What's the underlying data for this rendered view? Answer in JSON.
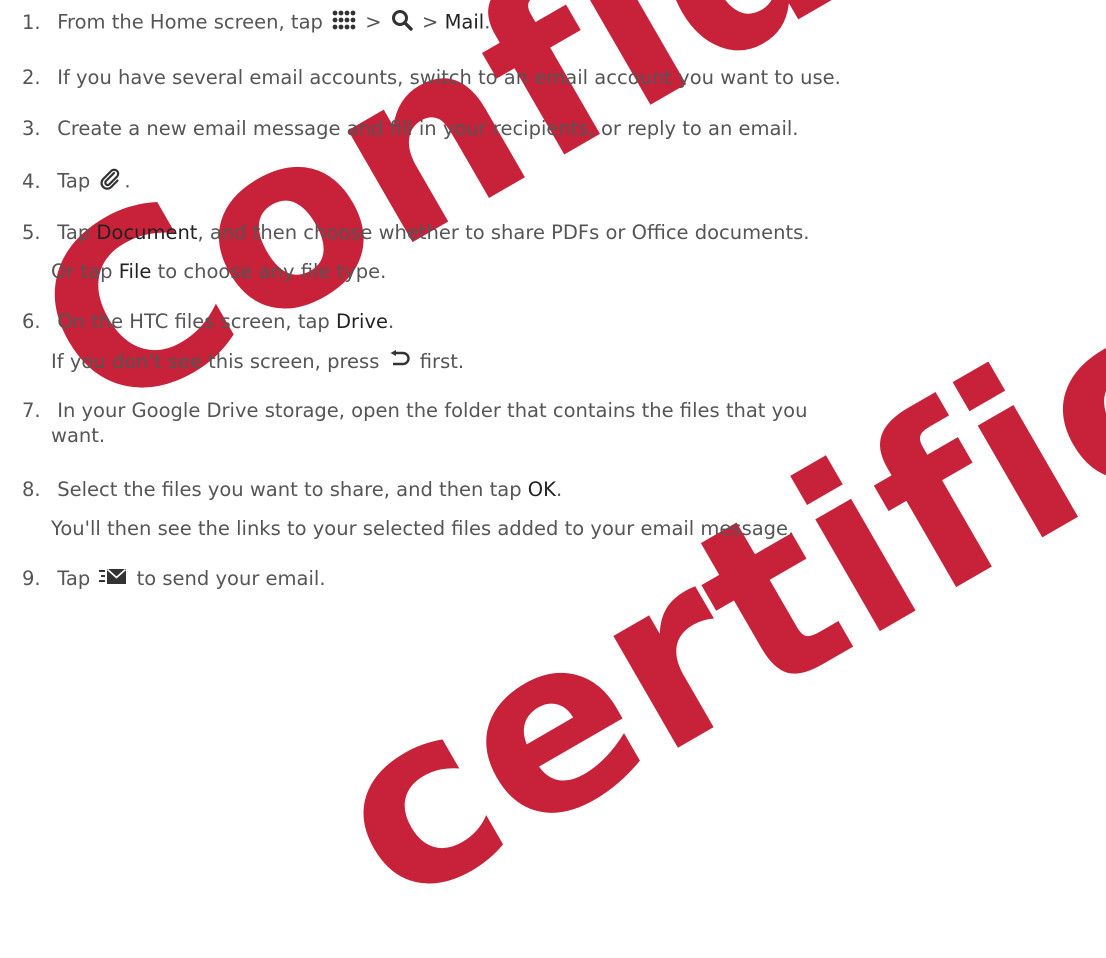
{
  "watermark": {
    "line1": "Confidential",
    "line2": "certification"
  },
  "steps": [
    {
      "num": "1.",
      "pre": "From the Home screen, tap",
      "sep1": ">",
      "sep2": ">",
      "bold": "Mail",
      "post": ".",
      "icons": [
        "apps-grid-icon",
        "search-icon"
      ]
    },
    {
      "num": "2.",
      "text": "If you have several email accounts, switch to an email account you want to use."
    },
    {
      "num": "3.",
      "text": "Create a new email message and fill in your recipients, or reply to an email."
    },
    {
      "num": "4.",
      "pre": "Tap",
      "post": ".",
      "icon": "paperclip-icon"
    },
    {
      "num": "5.",
      "pre": "Tap",
      "bold": "Document",
      "post": ", and then choose whether to share PDFs or Office documents.",
      "note_pre": "Or tap",
      "note_bold": "File",
      "note_post": "to choose any file type."
    },
    {
      "num": "6.",
      "pre": "On the HTC files screen, tap",
      "bold": "Drive",
      "post": ".",
      "note_pre": "If you don't see this screen, press",
      "note_post": "first.",
      "note_icon": "back-icon"
    },
    {
      "num": "7.",
      "line1": "In your Google Drive storage, open the folder that contains the files that you",
      "line2": "want."
    },
    {
      "num": "8.",
      "pre": "Select the files you want to share, and then tap",
      "bold": "OK",
      "post": ".",
      "note": "You'll then see the links to your selected files added to your email message."
    },
    {
      "num": "9.",
      "pre": "Tap",
      "post": "to send your email.",
      "icon": "send-icon"
    }
  ],
  "colors": {
    "text": "#555555",
    "highlight": "#222222",
    "watermark": "#c4102a"
  }
}
